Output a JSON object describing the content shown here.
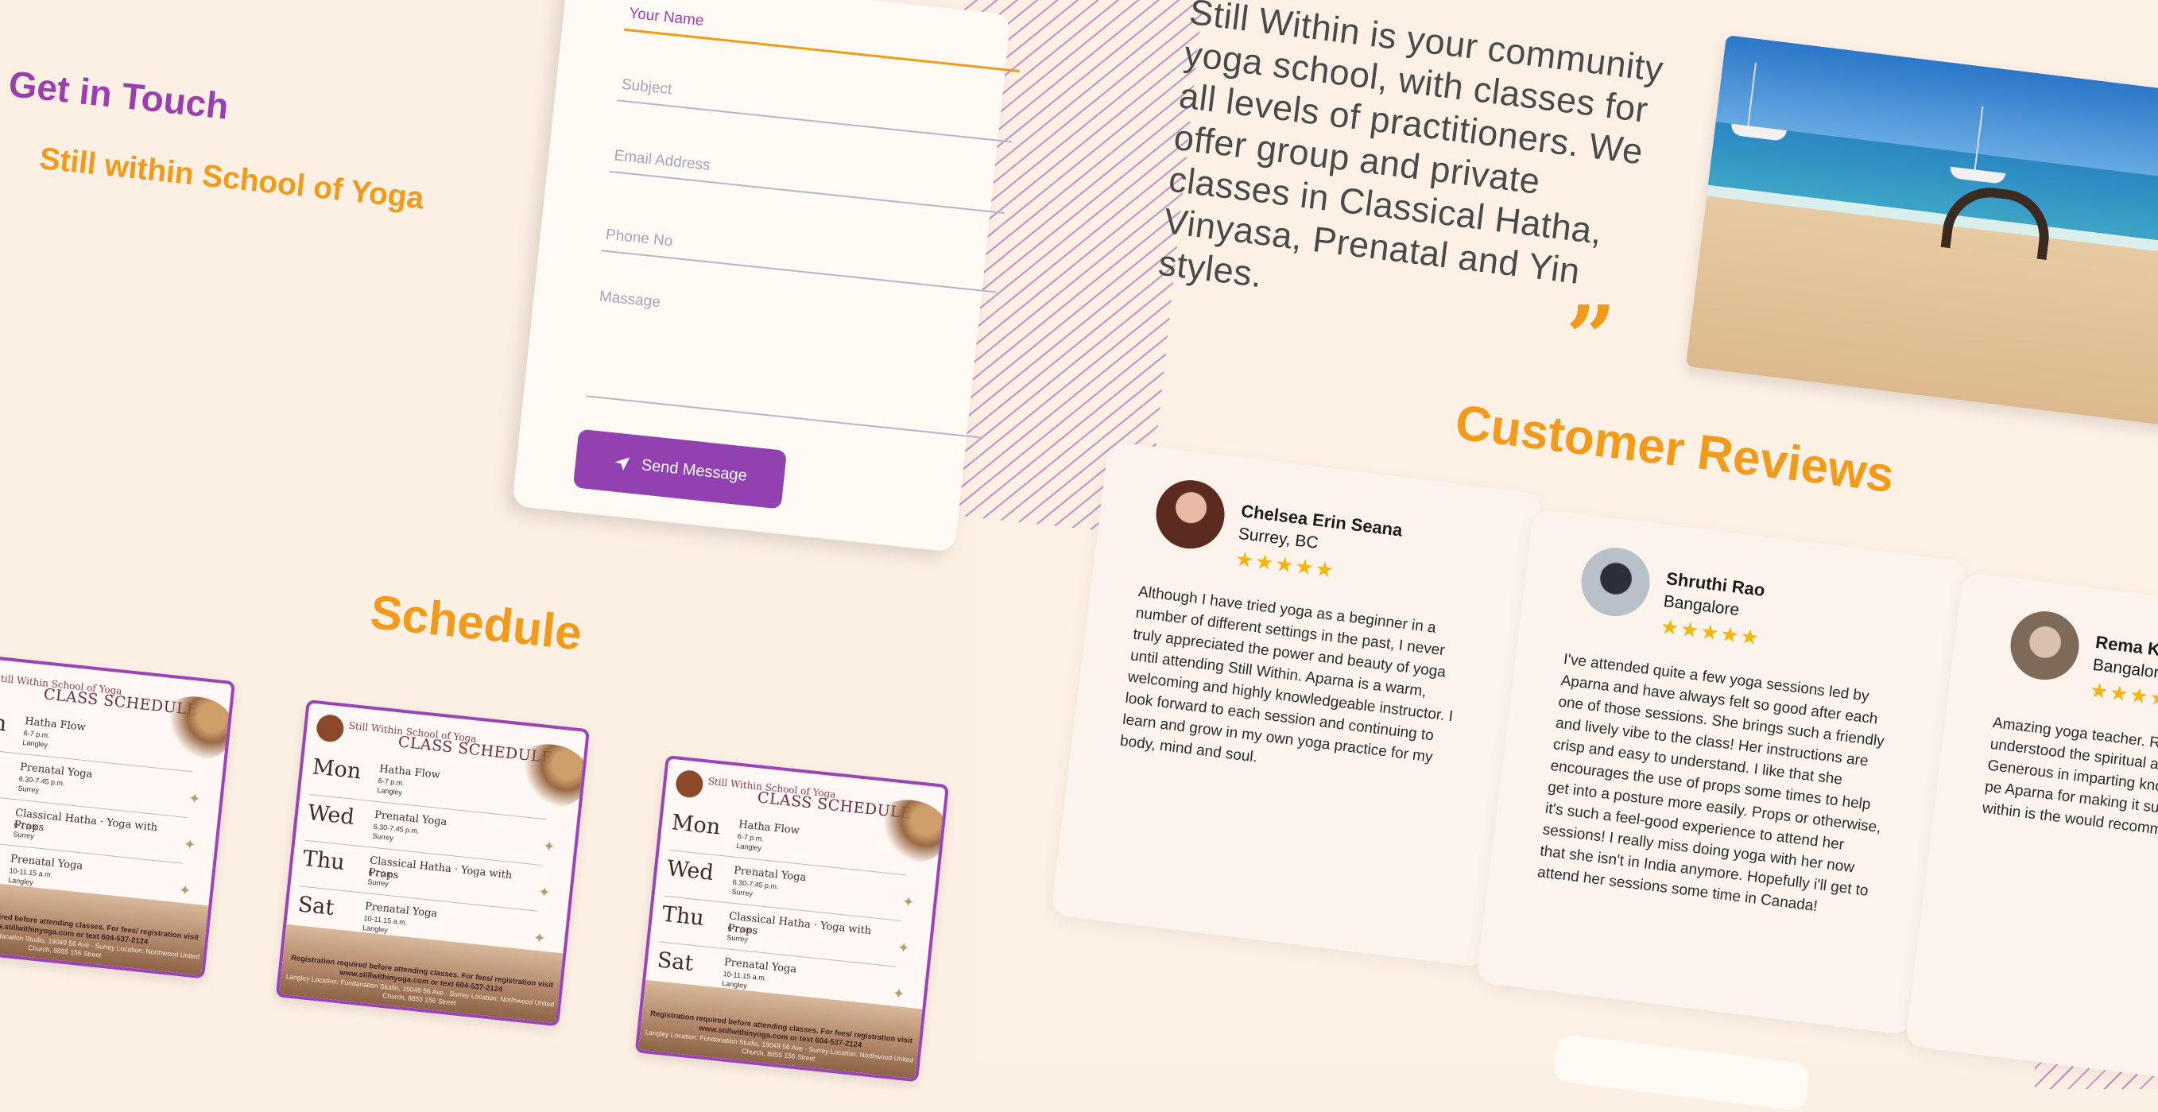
{
  "contact": {
    "heading": "Get in Touch",
    "school": "Still within School of Yoga",
    "fields": [
      {
        "placeholder": "Your Name"
      },
      {
        "placeholder": "Subject"
      },
      {
        "placeholder": "Email Address"
      },
      {
        "placeholder": "Phone No"
      },
      {
        "placeholder": "Massage"
      }
    ],
    "send_label": "Send Message"
  },
  "schedule": {
    "heading": "Schedule",
    "card": {
      "brand": "Still Within School of Yoga",
      "title": "CLASS SCHEDULE",
      "rows": [
        {
          "day": "Mon",
          "class": "Hatha Flow",
          "time": "6-7 p.m.",
          "location": "Langley"
        },
        {
          "day": "Wed",
          "class": "Prenatal Yoga",
          "time": "6.30-7.45 p.m.",
          "location": "Surrey"
        },
        {
          "day": "Thu",
          "class": "Classical Hatha · Yoga with Props",
          "time": "6-7 p.m.",
          "location": "Surrey"
        },
        {
          "day": "Sat",
          "class": "Prenatal Yoga",
          "time": "10-11.15 a.m.",
          "location": "Langley"
        }
      ],
      "footer": "Registration required before attending classes. For fees/ registration visit www.stillwithinyoga.com or text 604-537-2124",
      "locations": "Langley Location: Fundanation Studio, 19049 56 Ave · Surrey Location: Northwood United Church, 8855 156 Street"
    }
  },
  "about": {
    "quote": "Still Within is your community yoga school, with classes for all levels of practitioners. We offer group and private classes in Classical Hatha, Vinyasa, Prenatal and Yin styles."
  },
  "reviews": {
    "heading": "Customer Reviews",
    "items": [
      {
        "name": "Chelsea Erin Seana",
        "place": "Surrey, BC",
        "stars": "★★★★★",
        "text": "Although I have tried yoga as a beginner in a number of different settings in the past, I never truly appreciated the power and beauty of yoga until attending Still Within. Aparna is a warm, welcoming and highly knowledgeable instructor. I look forward to each session and continuing to learn and grow in my own yoga practice for my body, mind and soul."
      },
      {
        "name": "Shruthi Rao",
        "place": "Bangalore",
        "stars": "★★★★★",
        "text": "I've attended quite a few yoga sessions led by Aparna and have always felt so good after each one of those sessions. She brings such a friendly and lively vibe to the class! Her instructions are crisp and easy to understand. I like that she encourages the use of props some times to help get into a posture more easily. Props or otherwise, it's such a feel-good experience to attend her sessions! I really miss doing yoga with her now that she isn't in India anymore. Hopefully i'll get to attend her sessions some time in Canada!"
      },
      {
        "name": "Rema Kapo",
        "place": "Bangalore",
        "stars": "★★★★★",
        "text": "Amazing yoga teacher. R yoga teachers training pr understood the spiritual a aspect of yoga so clearly Generous in imparting kno making the practitioner pe Aparna for making it such a experience. Still within is the would recommend to all my"
      }
    ]
  },
  "colors": {
    "purple": "#9b3fb0",
    "orange": "#f29b1b",
    "background": "#fcefe3"
  }
}
